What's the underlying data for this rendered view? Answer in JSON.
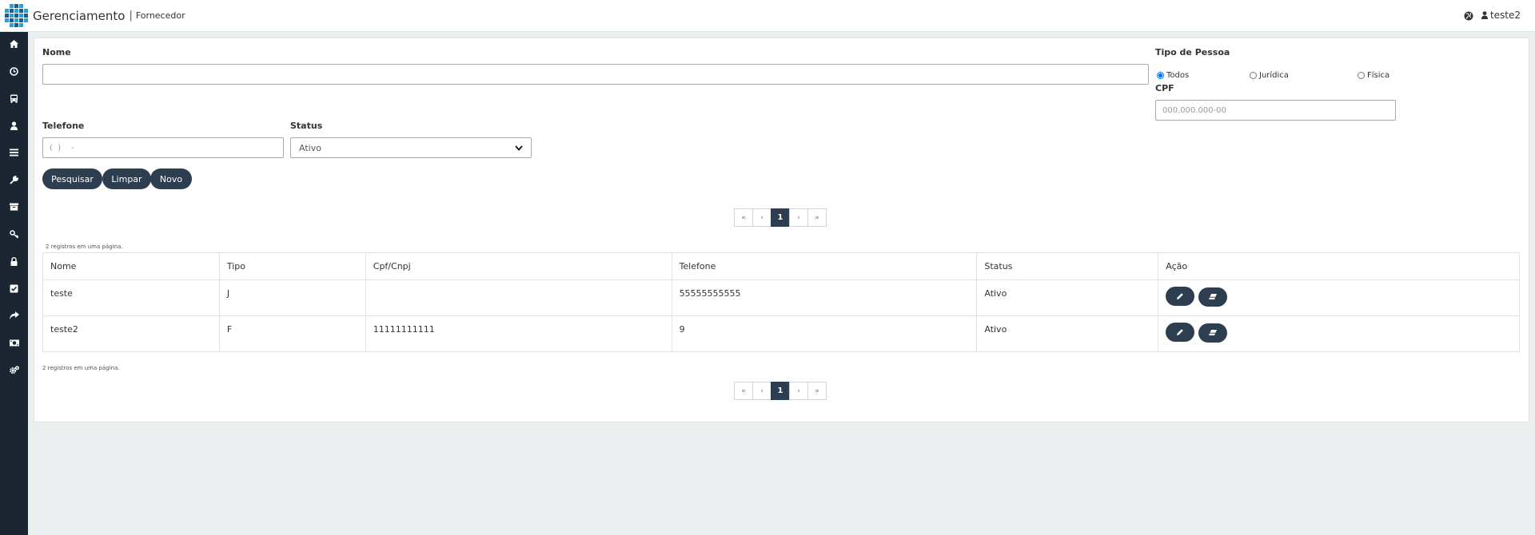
{
  "header": {
    "brand": "Gerenciamento",
    "separator": "|",
    "section": "Fornecedor",
    "user": "teste2",
    "icons": {
      "language": "globe-icon",
      "user": "user-icon"
    }
  },
  "sidebar": {
    "items": [
      {
        "icon": "home-icon"
      },
      {
        "icon": "clock-icon"
      },
      {
        "icon": "bus-icon"
      },
      {
        "icon": "user-icon"
      },
      {
        "icon": "list-icon"
      },
      {
        "icon": "wrench-icon"
      },
      {
        "icon": "archive-icon"
      },
      {
        "icon": "key-icon"
      },
      {
        "icon": "lock-icon"
      },
      {
        "icon": "checkbox-icon"
      },
      {
        "icon": "share-icon"
      },
      {
        "icon": "money-icon"
      },
      {
        "icon": "cogs-icon"
      }
    ]
  },
  "form": {
    "nome_label": "Nome",
    "nome_value": "",
    "tipo_label": "Tipo de Pessoa",
    "tipo_options": [
      "Todos",
      "Jurídica",
      "Física"
    ],
    "tipo_selected": "Todos",
    "cpf_label": "CPF",
    "cpf_placeholder": "000.000.000-00",
    "telefone_label": "Telefone",
    "telefone_placeholder": "(  )    -",
    "status_label": "Status",
    "status_value": "Ativo",
    "buttons": {
      "search": "Pesquisar",
      "clear": "Limpar",
      "new": "Novo"
    }
  },
  "pagination": {
    "first": "«",
    "prev": "‹",
    "current": "1",
    "next": "›",
    "last": "»"
  },
  "records_note": "2 registros em uma página.",
  "table": {
    "headers": [
      "Nome",
      "Tipo",
      "Cpf/Cnpj",
      "Telefone",
      "Status",
      "Ação"
    ],
    "rows": [
      [
        "teste",
        "J",
        "",
        "55555555555",
        "Ativo"
      ],
      [
        "teste2",
        "F",
        "11111111111",
        "9",
        "Ativo"
      ]
    ],
    "action_icons": {
      "edit": "pencil-icon",
      "delete": "eraser-icon"
    }
  },
  "colors": {
    "sidebar": "#1c2632",
    "primary": "#2c3e50",
    "logo": "#2a9fd8",
    "background": "#eceff0"
  }
}
